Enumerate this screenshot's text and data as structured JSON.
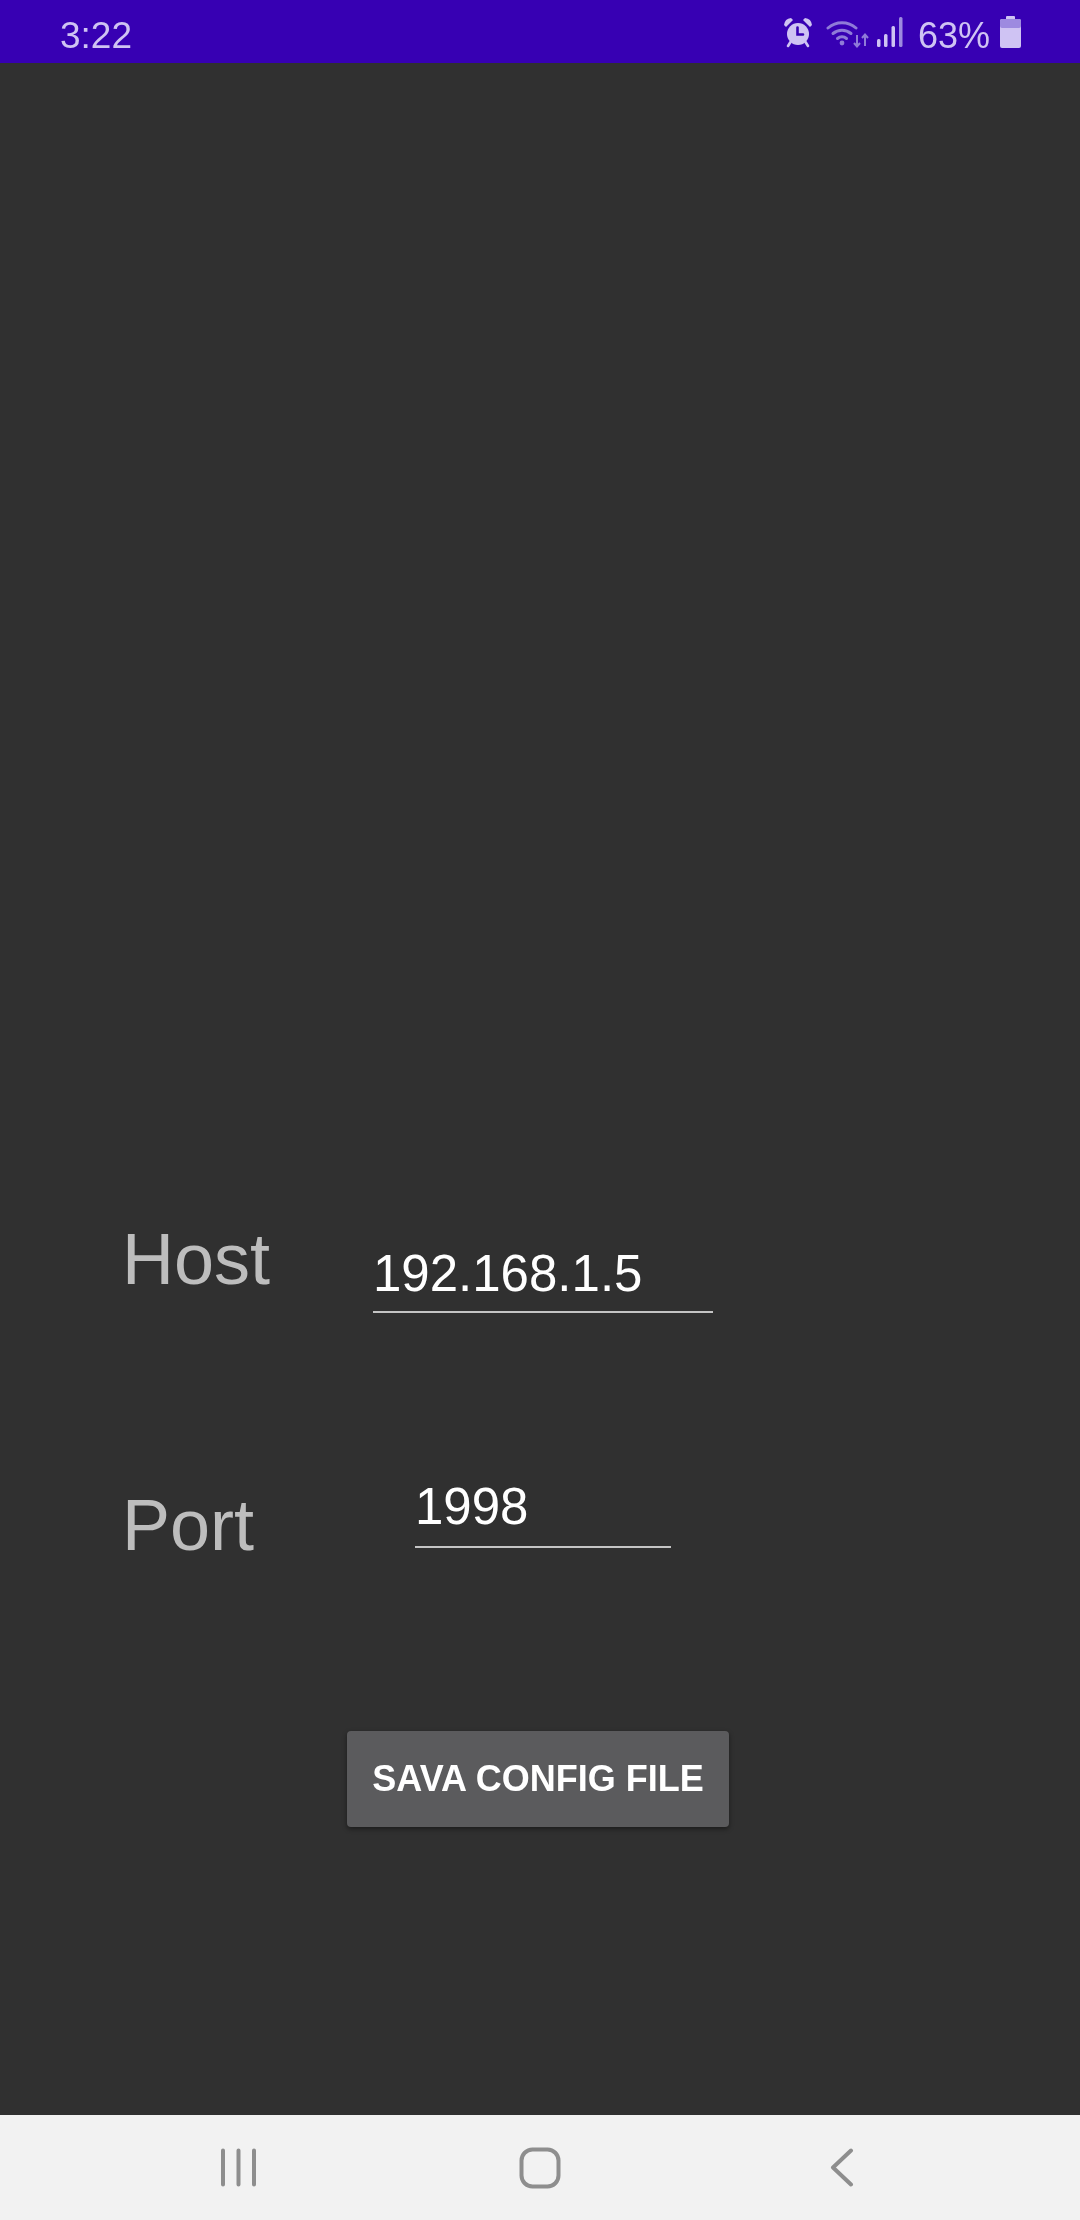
{
  "status_bar": {
    "time": "3:22",
    "battery": "63%"
  },
  "form": {
    "fields": [
      {
        "label": "Host",
        "value": "192.168.1.5"
      },
      {
        "label": "Port",
        "value": "1998"
      }
    ]
  },
  "button": {
    "label": "SAVA CONFIG FILE"
  }
}
